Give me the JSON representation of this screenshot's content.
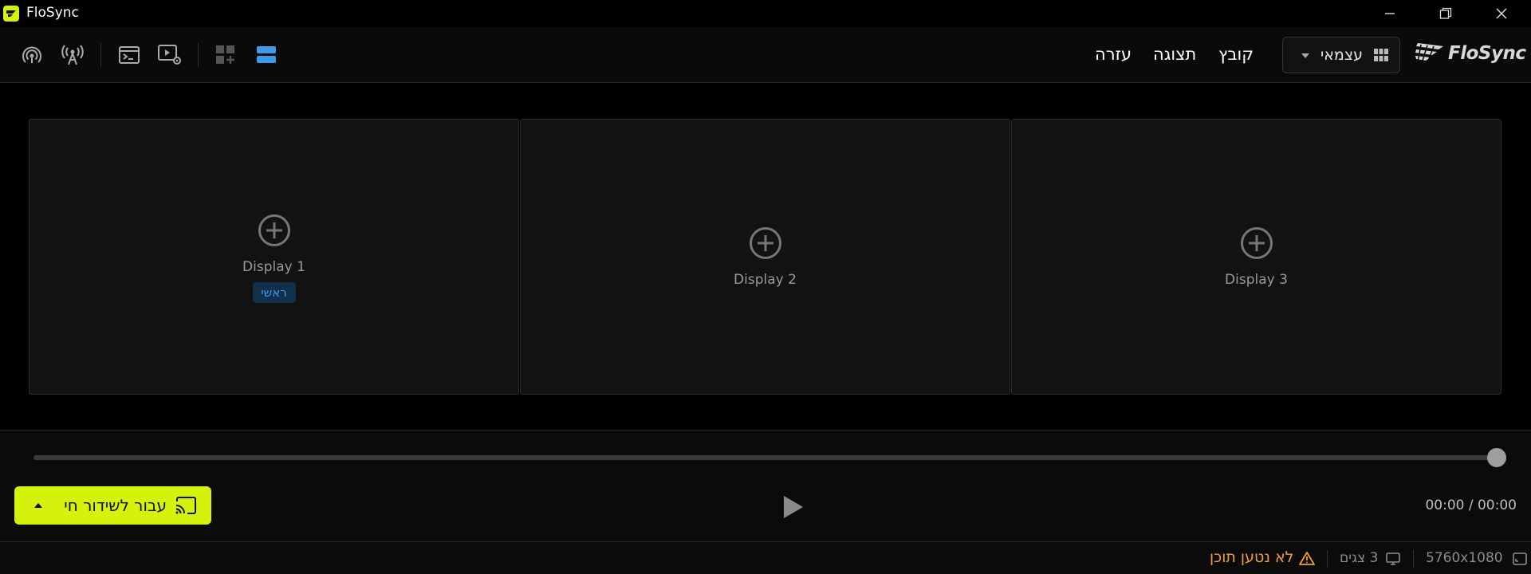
{
  "window": {
    "title": "FloSync"
  },
  "toolbar": {
    "menu": [
      "עזרה",
      "תצוגה",
      "קובץ"
    ],
    "mode": "עצמאי",
    "logo_text": "FloSync"
  },
  "displays": [
    {
      "label": "Display 1",
      "badge": "ראשי"
    },
    {
      "label": "Display 2"
    },
    {
      "label": "Display 3"
    }
  ],
  "player": {
    "go_live": "עבור לשידור חי",
    "time": "00:00 / 00:00",
    "progress": 1.0
  },
  "status": {
    "resolution": "5760x1080",
    "screens": "3 צגים",
    "warning": "לא נטען תוכן"
  },
  "colors": {
    "accent": "#d4f20c",
    "primary_badge": "#3d9ae8",
    "warning": "#f0a030"
  }
}
